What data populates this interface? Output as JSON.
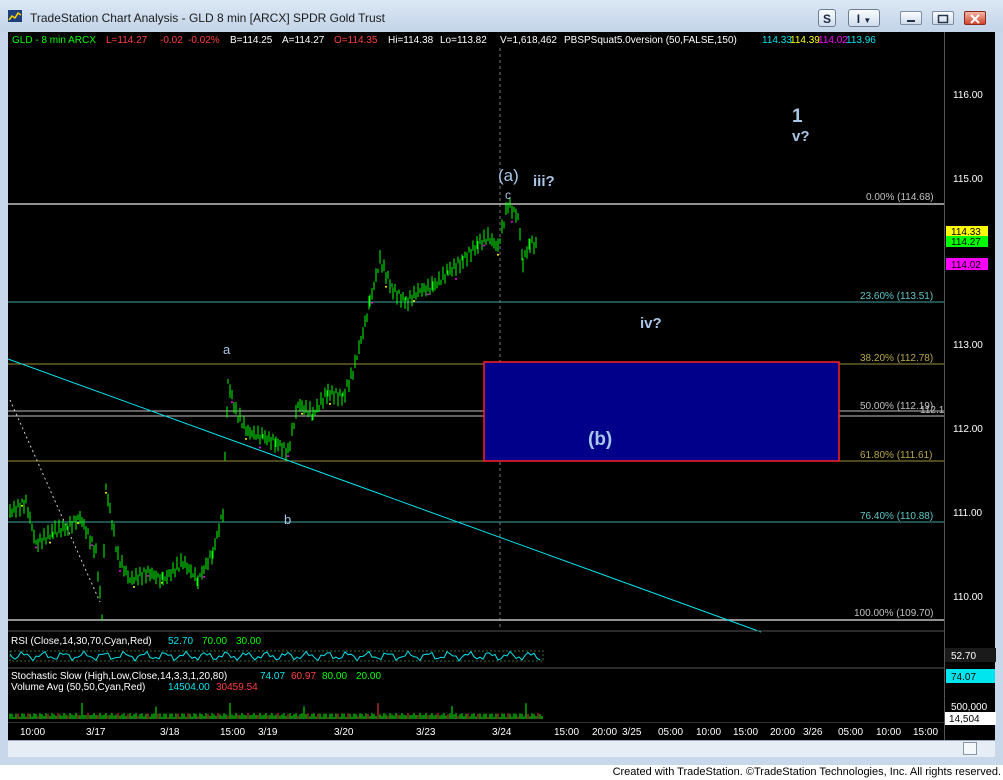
{
  "window": {
    "title": "TradeStation Chart Analysis - GLD 8 min [ARCX] SPDR Gold Trust",
    "btn_s": "S",
    "btn_i": "I"
  },
  "colors": {
    "up": "#00ff00",
    "cyan": "#00e5ee",
    "yellow": "#ffff00",
    "magenta": "#ff00ff",
    "fib": "#5fc8c8",
    "box_fill": "#00008b",
    "box_border": "#ff2020",
    "label": "#a9c6e8"
  },
  "status": {
    "symbol": "GLD - 8 min  ARCX",
    "last": "L=114.27",
    "chg": "-0.02",
    "pct": "-0.02%",
    "bid": "B=114.25",
    "ask": "A=114.27",
    "open": "O=114.35",
    "hi": "Hi=114.38",
    "lo": "Lo=113.82",
    "vol": "V=1,618,462",
    "study": "PBSPSquat5.0version (50,FALSE,150)",
    "s1": "114.33",
    "s2": "114.39",
    "s3": "114.02",
    "s4": "113.96"
  },
  "fib_levels": [
    {
      "label": "0.00% (114.68)"
    },
    {
      "label": "23.60% (113.51)"
    },
    {
      "label": "38.20% (112.78)"
    },
    {
      "label": "50.00% (112.19)"
    },
    {
      "label": "61.80% (111.61)"
    },
    {
      "label": "76.40% (110.88)"
    },
    {
      "label": "100.00% (109.70)"
    }
  ],
  "hline_extra": "112.15",
  "wave_labels": {
    "a_paren": "(a)",
    "c": "c",
    "iii": "iii?",
    "one": "1",
    "v": "v?",
    "iv": "iv?",
    "b_paren": "(b)",
    "a": "a",
    "b": "b"
  },
  "price_axis": [
    "116.00",
    "115.00",
    "114.00",
    "113.00",
    "112.00",
    "111.00",
    "110.00"
  ],
  "price_tags": [
    "114.33",
    "114.27",
    "114.02"
  ],
  "rsi": {
    "label": "RSI (Close,14,30,70,Cyan,Red)",
    "v1": "52.70",
    "v2": "70.00",
    "v3": "30.00",
    "axis": "52.70"
  },
  "stoch": {
    "label": "Stochastic Slow (High,Low,Close,14,3,3,1,20,80)",
    "v1": "74.07",
    "v2": "60.97",
    "v3": "80.00",
    "v4": "20.00",
    "axis": "74.07"
  },
  "volume": {
    "label": "Volume Avg (50,50,Cyan,Red)",
    "v1": "14504.00",
    "v2": "30459.54",
    "axis1": "500,000",
    "axis2": "14,504"
  },
  "time_axis": [
    "10:00",
    "3/17",
    "3/18",
    "15:00",
    "3/19",
    "3/20",
    "3/23",
    "3/24",
    "15:00",
    "20:00",
    "3/25",
    "05:00",
    "10:00",
    "15:00",
    "20:00",
    "3/26",
    "05:00",
    "10:00",
    "15:00"
  ],
  "footer": "Created with TradeStation. ©TradeStation Technologies, Inc. All rights reserved."
}
